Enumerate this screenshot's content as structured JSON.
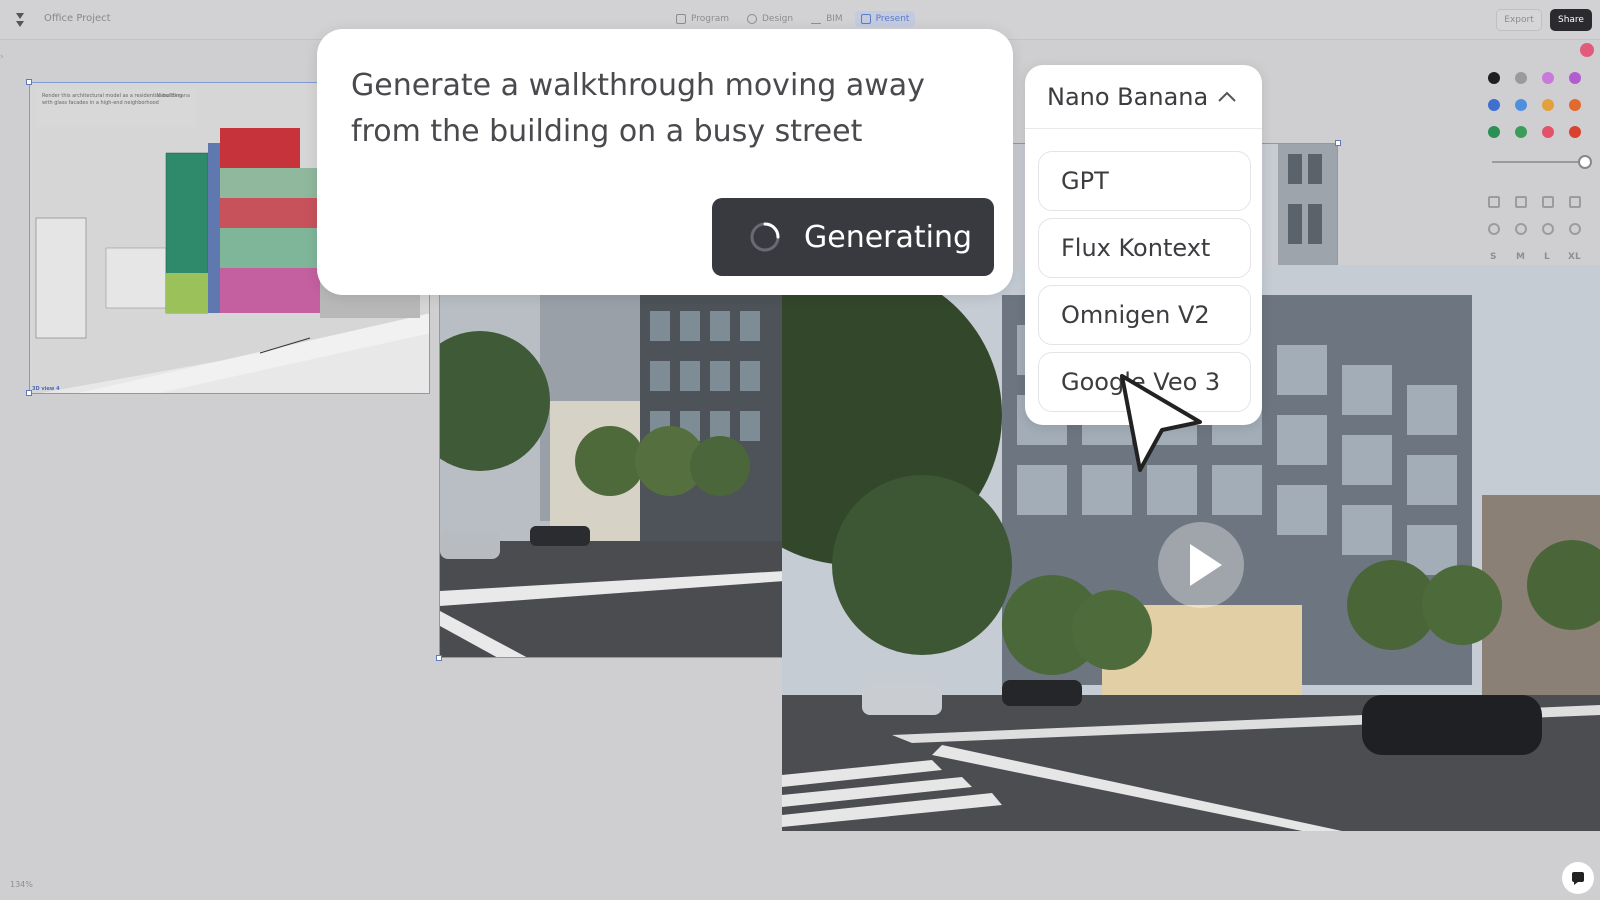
{
  "app": {
    "project_name": "Office Project",
    "modes": [
      {
        "label": "Program",
        "icon": "grid-icon"
      },
      {
        "label": "Design",
        "icon": "shapes-icon"
      },
      {
        "label": "BIM",
        "icon": "building-icon"
      },
      {
        "label": "Present",
        "icon": "present-icon",
        "active": true
      }
    ],
    "export_label": "Export",
    "share_label": "Share",
    "side_toggle": "›",
    "zoom_level": "134%"
  },
  "canvas": {
    "frame1": {
      "note_text": "Render this architectural model as a residential building with glass facades in a high-end neighborhood",
      "model_chip": "Nano Banana",
      "label": "3D view 4"
    }
  },
  "prompt": {
    "text": "Generate a walkthrough moving away from the building on a busy street",
    "button_label": "Generating"
  },
  "model_dropdown": {
    "selected": "Nano Banana",
    "options": [
      "GPT",
      "Flux Kontext",
      "Omnigen V2",
      "Google Veo 3"
    ]
  },
  "tools": {
    "colors": [
      "#1f1f1f",
      "#9a9a9d",
      "#c77ad9",
      "#b35bd1",
      "#3f6fd1",
      "#4f8fe0",
      "#e3a13e",
      "#e26a2c",
      "#2e8f54",
      "#3a9d5a",
      "#e2536a",
      "#d9432e"
    ],
    "sizes": [
      "S",
      "M",
      "L",
      "XL"
    ]
  }
}
